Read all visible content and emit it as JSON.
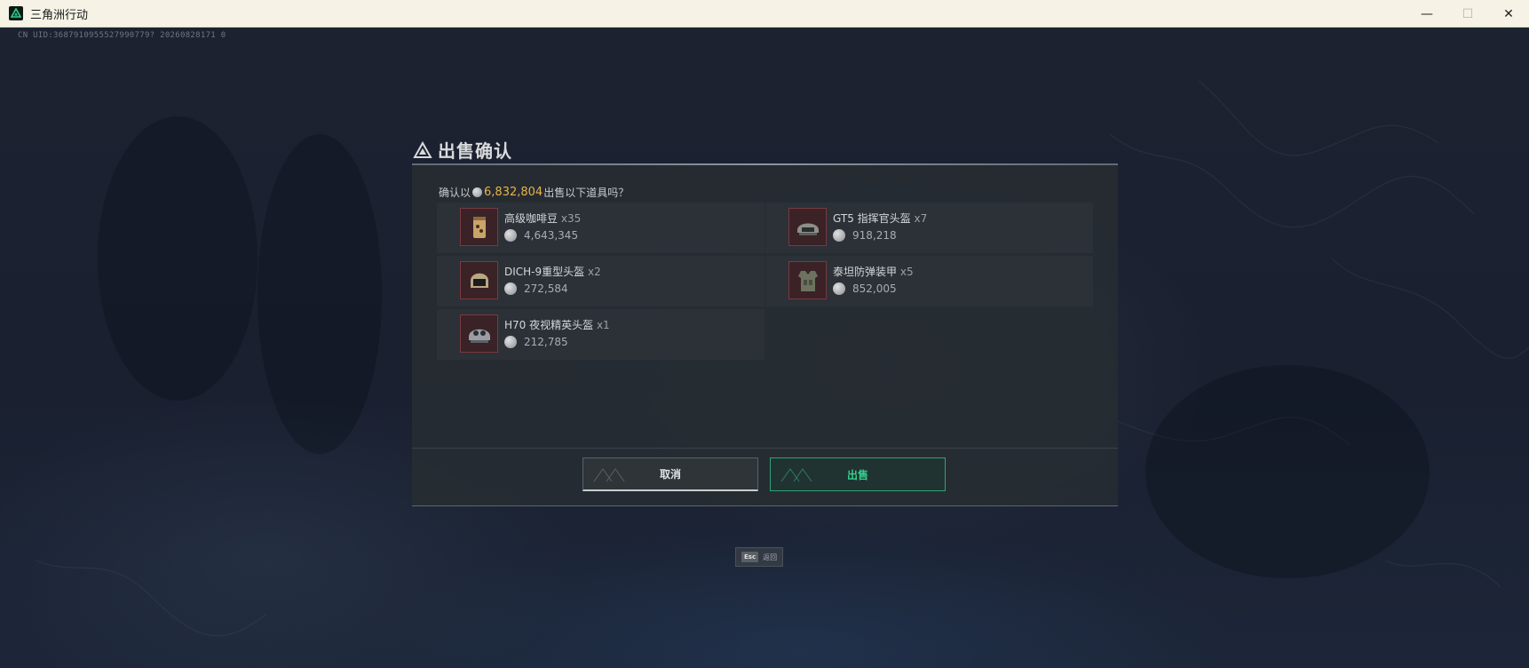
{
  "window": {
    "title": "三角洲行动",
    "minimize": "—",
    "maximize": "☐",
    "close": "✕"
  },
  "uid": "CN UID:3687910955527990779? 20260828171 0",
  "dialog": {
    "title": "出售确认",
    "confirm_prefix": "确认以",
    "total": "6,832,804",
    "confirm_suffix": "出售以下道具吗？",
    "items": [
      {
        "name": "高级咖啡豆",
        "qty": "x35",
        "price": "4,643,345",
        "icon": "coffee-bean-bag-icon"
      },
      {
        "name": "GT5 指挥官头盔",
        "qty": "x7",
        "price": "918,218",
        "icon": "helmet-icon"
      },
      {
        "name": "DICH-9重型头盔",
        "qty": "x2",
        "price": "272,584",
        "icon": "heavy-helmet-icon"
      },
      {
        "name": "泰坦防弹装甲",
        "qty": "x5",
        "price": "852,005",
        "icon": "body-armor-icon"
      },
      {
        "name": "H70 夜视精英头盔",
        "qty": "x1",
        "price": "212,785",
        "icon": "night-vision-helmet-icon"
      }
    ],
    "cancel_label": "取消",
    "sell_label": "出售"
  },
  "esc_hint": {
    "key": "Esc",
    "label": "返回"
  },
  "colors": {
    "accent_green": "#34d08f",
    "price_gold": "#e8b34a",
    "item_border_red": "#7a3a3f"
  }
}
